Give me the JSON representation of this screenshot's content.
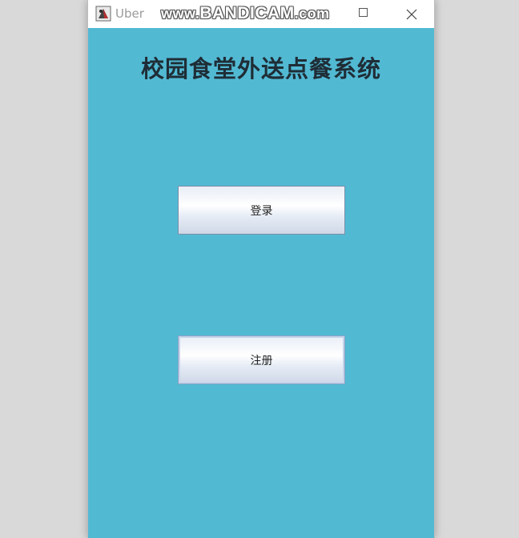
{
  "window": {
    "title": "Uber",
    "watermark": {
      "prefix": "www.",
      "brand": "BANDICAM",
      "suffix": ".com"
    },
    "icons": [
      "app-icon",
      "maximize-icon",
      "close-icon"
    ]
  },
  "main": {
    "title": "校园食堂外送点餐系统",
    "login_label": "登录",
    "register_label": "注册"
  },
  "colors": {
    "background": "#52b9d3",
    "title_text": "#1f2d36"
  }
}
